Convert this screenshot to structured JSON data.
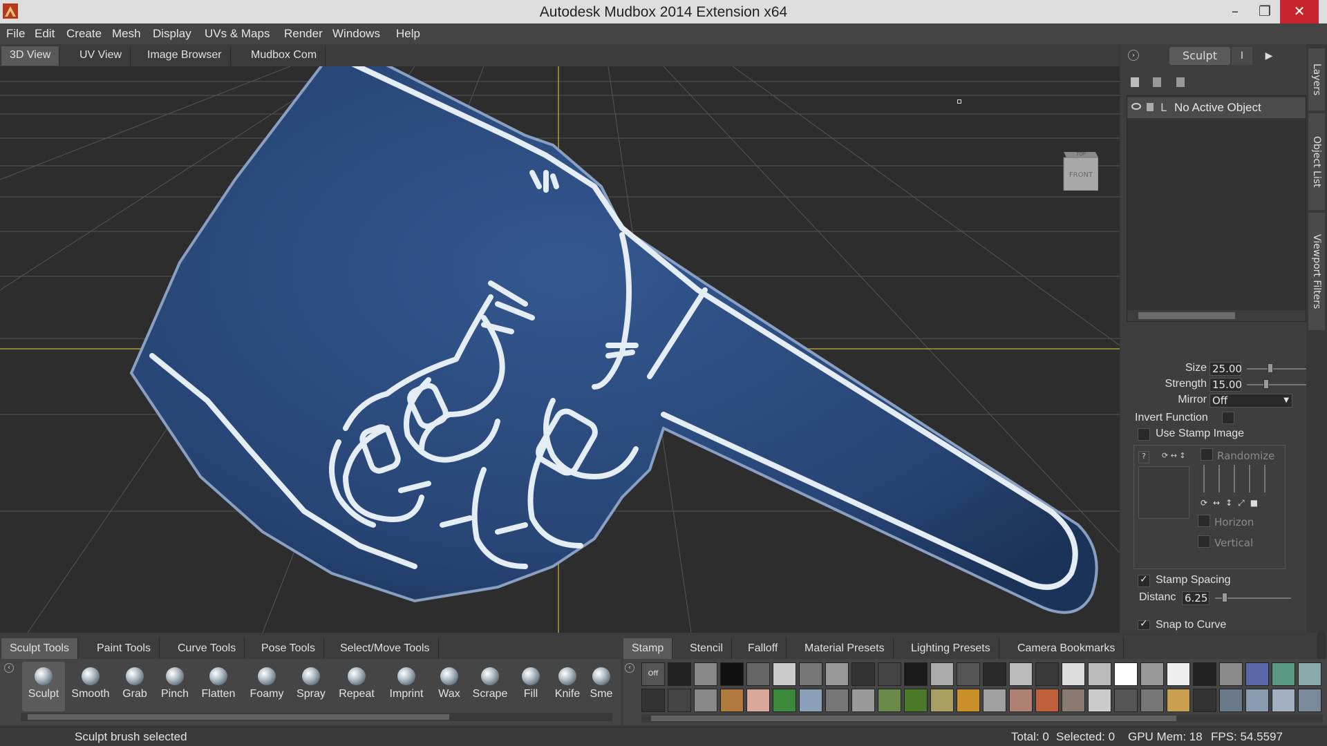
{
  "app": {
    "title": "Autodesk Mudbox 2014 Extension x64"
  },
  "window_controls": {
    "minimize": "–",
    "maximize": "❐",
    "close": "✕"
  },
  "menu": [
    "File",
    "Edit",
    "Create",
    "Mesh",
    "Display",
    "UVs & Maps",
    "Render",
    "Windows",
    "Help"
  ],
  "view_tabs": [
    "3D View",
    "UV View",
    "Image Browser",
    "Mudbox Com"
  ],
  "viewcube": {
    "top": "TOP",
    "front": "FRONT"
  },
  "right_panel": {
    "tab_label": "Sculpt",
    "tab_label_2": "I",
    "layer_flag": "L",
    "no_object": "No Active Object",
    "size_label": "Size",
    "size_value": "25.00",
    "strength_label": "Strength",
    "strength_value": "15.00",
    "mirror_label": "Mirror",
    "mirror_value": "Off",
    "invert_label": "Invert Function",
    "use_stamp_label": "Use Stamp Image",
    "randomize_label": "Randomize",
    "horizon_label": "Horizon",
    "vertical_label": "Vertical",
    "stamp_spacing_label": "Stamp Spacing",
    "distance_label": "Distanc",
    "distance_value": "6.25",
    "snap_label": "Snap to Curve"
  },
  "side_tabs": [
    "Layers",
    "Object List",
    "Viewport Filters"
  ],
  "bottom_tabs_left": [
    "Sculpt Tools",
    "Paint Tools",
    "Curve Tools",
    "Pose Tools",
    "Select/Move Tools"
  ],
  "bottom_tabs_right": [
    "Stamp",
    "Stencil",
    "Falloff",
    "Material Presets",
    "Lighting Presets",
    "Camera Bookmarks"
  ],
  "tools": [
    "Sculpt",
    "Smooth",
    "Grab",
    "Pinch",
    "Flatten",
    "Foamy",
    "Spray",
    "Repeat",
    "Imprint",
    "Wax",
    "Scrape",
    "Fill",
    "Knife",
    "Sme"
  ],
  "stamp_off_label": "Off",
  "status": {
    "message": "Sculpt brush selected",
    "total": "Total: 0",
    "selected": "Selected: 0",
    "gpu_mem": "GPU Mem: 18",
    "fps": "FPS: 54.5597"
  },
  "colors": {
    "foam_blue": "#2c4e86",
    "foam_outline": "#e4ecf4",
    "close_red": "#c7252b",
    "axis_yellow": "#b59a3c"
  }
}
